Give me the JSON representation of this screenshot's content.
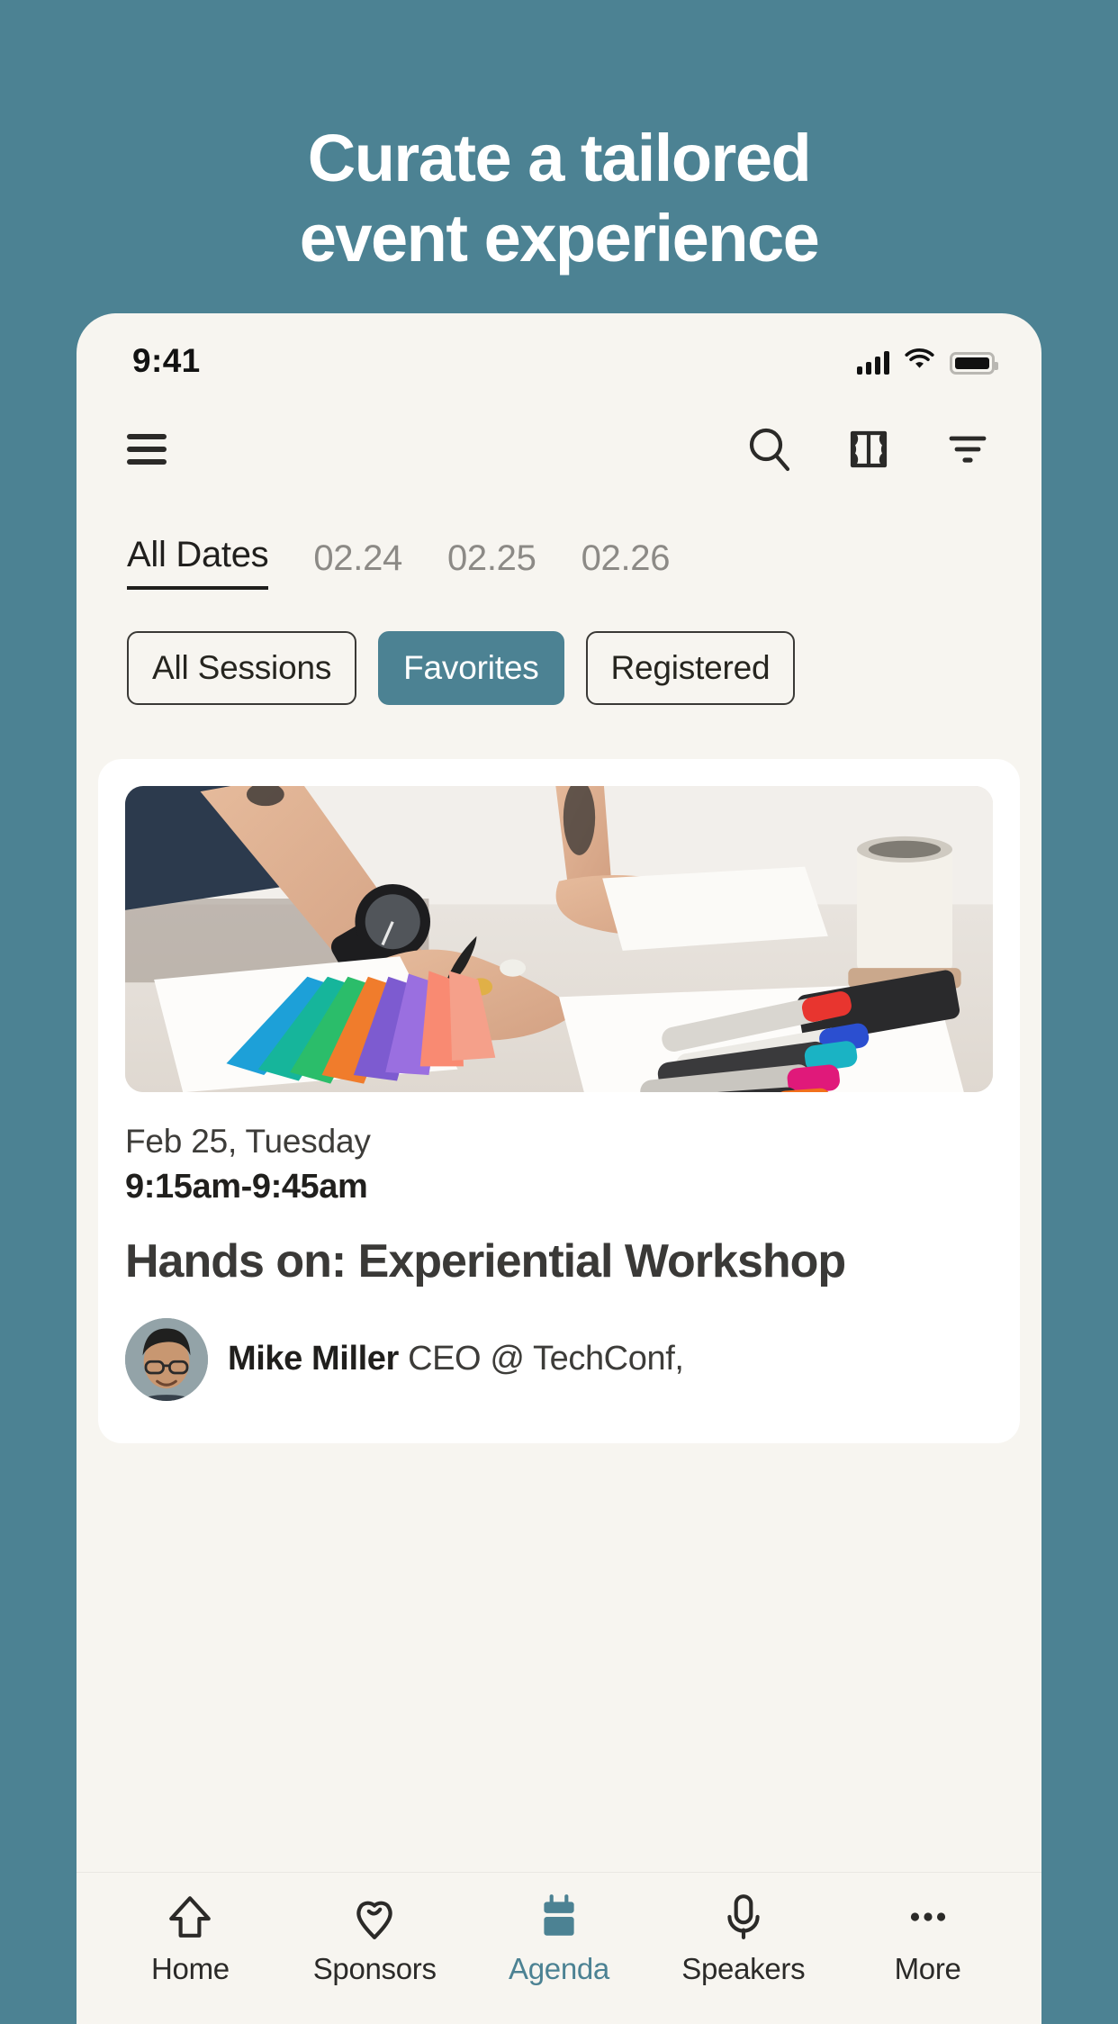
{
  "promo": {
    "headline_line1": "Curate a tailored",
    "headline_line2": "event experience",
    "background_color": "#4c8293",
    "text_color": "#ffffff"
  },
  "phone": {
    "status_bar": {
      "time": "9:41",
      "cellular_icon": "signal-bars-icon",
      "wifi_icon": "wifi-icon",
      "battery_icon": "battery-full-icon"
    },
    "app_bar": {
      "menu_icon": "hamburger-menu-icon",
      "search_icon": "search-icon",
      "ticket_icon": "ticket-icon",
      "filter_icon": "filter-icon"
    },
    "date_tabs": {
      "items": [
        {
          "label": "All Dates",
          "active": true
        },
        {
          "label": "02.24",
          "active": false
        },
        {
          "label": "02.25",
          "active": false
        },
        {
          "label": "02.26",
          "active": false
        }
      ]
    },
    "filter_chips": {
      "items": [
        {
          "label": "All Sessions",
          "selected": false
        },
        {
          "label": "Favorites",
          "selected": true
        },
        {
          "label": "Registered",
          "selected": false
        }
      ],
      "selected_color": "#4c8293"
    },
    "session_card": {
      "image_alt": "designer-hands-color-swatches-markers-photo",
      "date": "Feb 25, Tuesday",
      "time": "9:15am-9:45am",
      "title": "Hands on: Experiential Workshop",
      "speaker_name": "Mike Miller",
      "speaker_role": "CEO @ TechConf,",
      "speaker_avatar": "speaker-avatar"
    },
    "bottom_nav": {
      "active_color": "#4c8293",
      "items": [
        {
          "label": "Home",
          "icon": "home-icon",
          "active": false
        },
        {
          "label": "Sponsors",
          "icon": "heart-pin-icon",
          "active": false
        },
        {
          "label": "Agenda",
          "icon": "calendar-icon",
          "active": true
        },
        {
          "label": "Speakers",
          "icon": "microphone-icon",
          "active": false
        },
        {
          "label": "More",
          "icon": "ellipsis-icon",
          "active": false
        }
      ]
    }
  }
}
